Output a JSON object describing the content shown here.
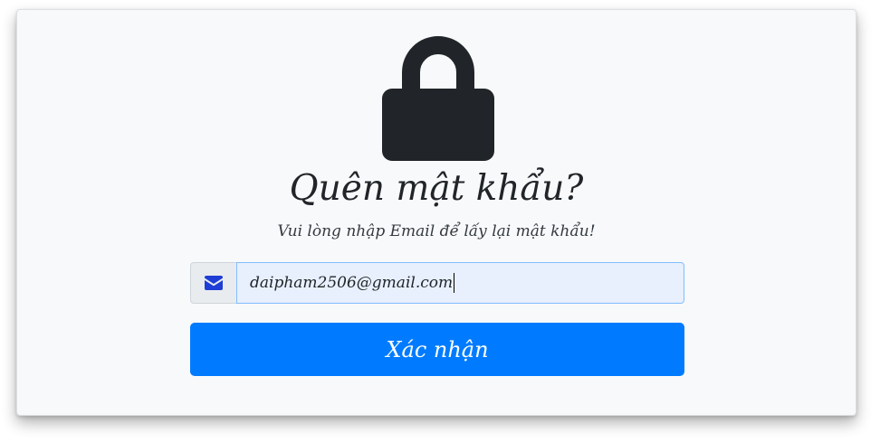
{
  "header": {
    "title": "Quên mật khẩu?",
    "subtitle": "Vui lòng nhập Email để lấy lại mật khẩu!"
  },
  "form": {
    "email_icon": "envelope-icon",
    "email_value": "daipham2506@gmail.com",
    "submit_label": "Xác nhận"
  },
  "icons": {
    "main": "lock-icon"
  },
  "colors": {
    "primary": "#007bff",
    "icon_dark": "#212529",
    "envelope": "#1e3ed6"
  }
}
